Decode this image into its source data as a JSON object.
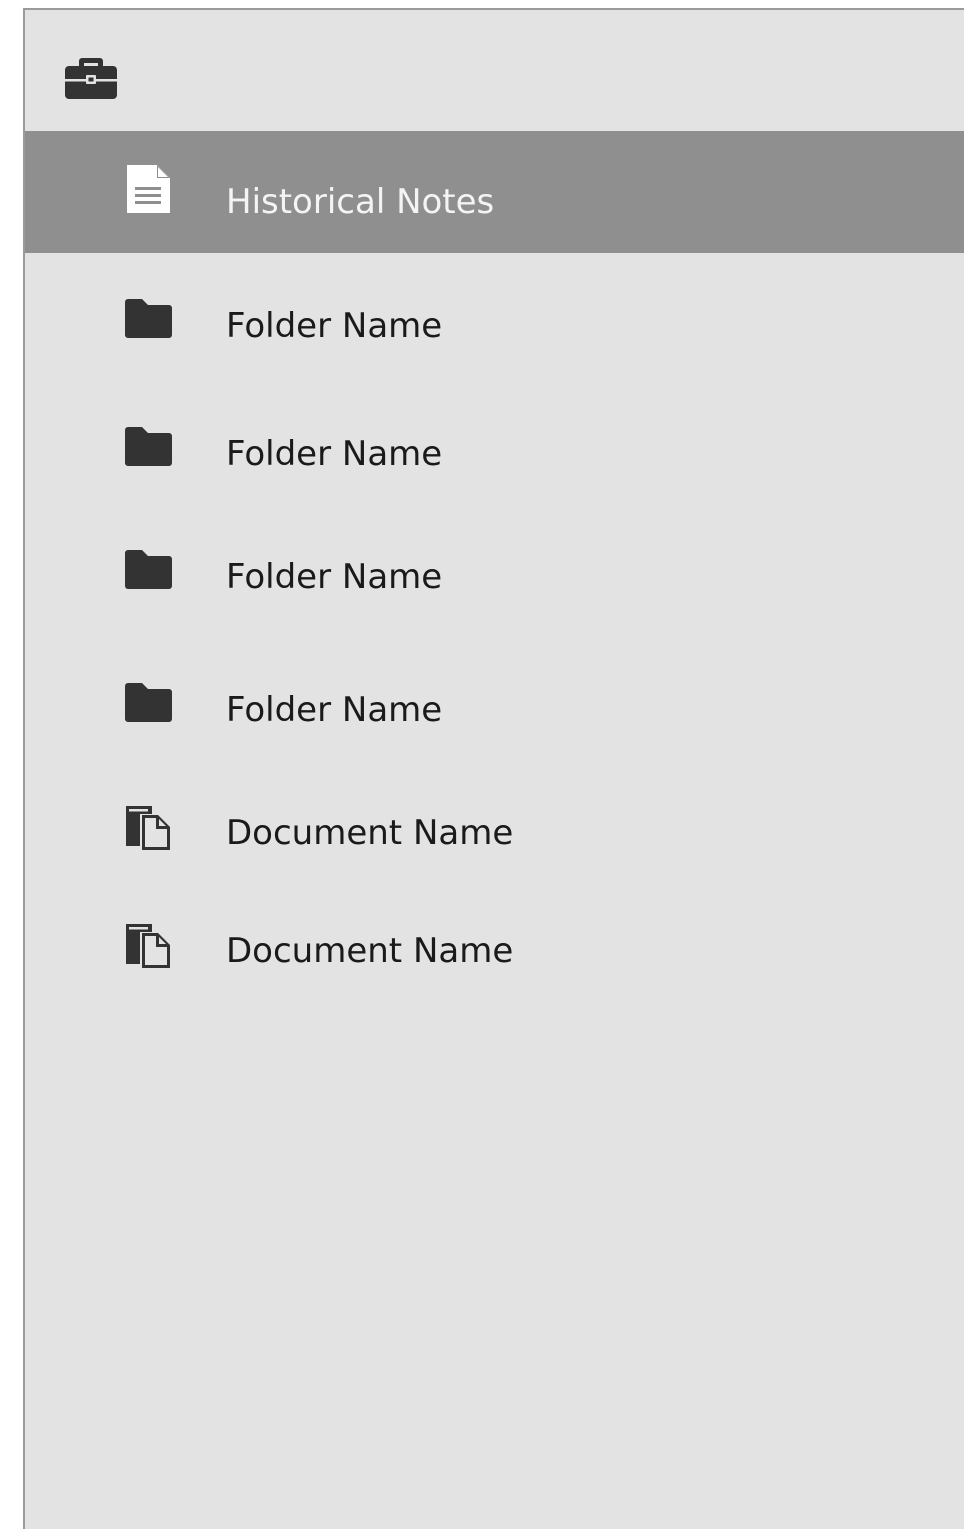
{
  "header": {
    "icon": "briefcase-icon"
  },
  "items": [
    {
      "label": "Historical Notes",
      "icon": "document-icon",
      "selected": true
    },
    {
      "label": "Folder Name",
      "icon": "folder-icon",
      "selected": false
    },
    {
      "label": "Folder Name",
      "icon": "folder-icon",
      "selected": false
    },
    {
      "label": "Folder Name",
      "icon": "folder-icon",
      "selected": false
    },
    {
      "label": "Folder Name",
      "icon": "folder-icon",
      "selected": false
    },
    {
      "label": "Document Name",
      "icon": "copy-document-icon",
      "selected": false
    },
    {
      "label": "Document Name",
      "icon": "copy-document-icon",
      "selected": false
    }
  ],
  "colors": {
    "panel_background": "#e3e3e3",
    "selected_background": "#8f8f8f",
    "icon_color": "#333333",
    "selected_text": "#f4f4f4"
  }
}
